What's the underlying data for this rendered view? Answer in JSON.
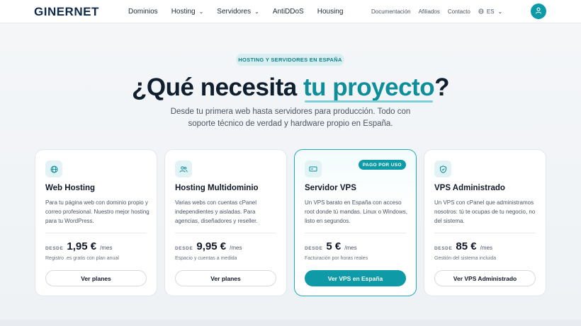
{
  "header": {
    "logo_text": "GINERNET",
    "nav": [
      {
        "label": "Dominios",
        "has_dropdown": false
      },
      {
        "label": "Hosting",
        "has_dropdown": true
      },
      {
        "label": "Servidores",
        "has_dropdown": true
      },
      {
        "label": "AntiDDoS",
        "has_dropdown": false
      },
      {
        "label": "Housing",
        "has_dropdown": false
      }
    ],
    "utils": [
      "Documentación",
      "Afiliados",
      "Contacto"
    ],
    "language": "ES",
    "icons": {
      "user": "user-icon",
      "globe": "globe-icon",
      "chevron": "chevron-down-icon"
    }
  },
  "hero": {
    "badge": "HOSTING Y SERVIDORES EN ESPAÑA",
    "headline_prefix": "¿Qué necesita ",
    "headline_accent": "tu proyecto",
    "headline_suffix": "?",
    "subtitle": "Desde tu primera web hasta servidores para producción. Todo con soporte técnico de verdad y hardware propio en España."
  },
  "cards": [
    {
      "icon": "globe-icon",
      "title": "Web Hosting",
      "description": "Para tu página web con dominio propio y correo profesional. Nuestro mejor hosting para tu WordPress.",
      "from_label": "DESDE",
      "price": "1,95 €",
      "per": "/mes",
      "note": "Registro .es gratis con plan anual",
      "button": "Ver planes",
      "featured": false
    },
    {
      "icon": "users-icon",
      "title": "Hosting Multidominio",
      "description": "Varias webs con cuentas cPanel independientes y aisladas. Para agencias, diseñadores y reseller.",
      "from_label": "DESDE",
      "price": "9,95 €",
      "per": "/mes",
      "note": "Espacio y cuentas a medida",
      "button": "Ver planes",
      "featured": false
    },
    {
      "icon": "server-icon",
      "title": "Servidor VPS",
      "badge": "PAGO POR USO",
      "description": "Un VPS barato en España con acceso root donde tú mandas. Linux o Windows, listo en segundos.",
      "from_label": "DESDE",
      "price": "5 €",
      "per": "/mes",
      "note": "Facturación por horas reales",
      "button": "Ver VPS en España",
      "featured": true
    },
    {
      "icon": "shield-icon",
      "title": "VPS Administrado",
      "description": "Un VPS con cPanel que administramos nosotros: tú te ocupas de tu negocio, no del sistema.",
      "from_label": "DESDE",
      "price": "85 €",
      "per": "/mes",
      "note": "Gestión del sistema incluida",
      "button": "Ver VPS Administrado",
      "featured": false
    }
  ],
  "colors": {
    "accent": "#0e9aa7",
    "text_dark": "#0f1f2e"
  }
}
